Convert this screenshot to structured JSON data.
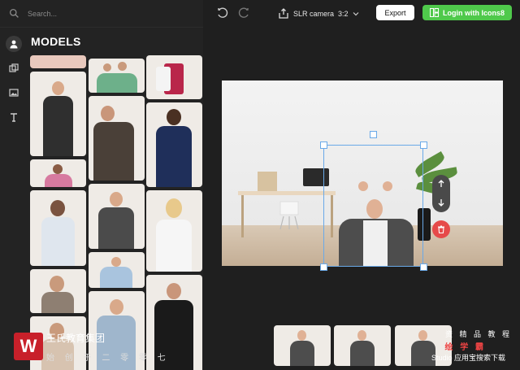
{
  "search": {
    "placeholder": "Search..."
  },
  "rail": {
    "items": [
      "models-icon",
      "layers-icon",
      "image-icon",
      "text-icon"
    ]
  },
  "panel": {
    "title": "MODELS"
  },
  "toolbar": {
    "camera_label": "SLR camera",
    "ratio_label": "3:2",
    "export_label": "Export",
    "login_label": "Login with Icons8"
  },
  "colors": {
    "accent_green": "#4fc94b",
    "selection_blue": "#6aa9e8",
    "delete_red": "#e64a4a"
  },
  "watermark": {
    "line1": "王氏教育集团",
    "line2": "始 创 于 二 零 零 七",
    "right_line1": "资 精 品 教 程",
    "right_line2": "绘 学 霸",
    "right_line3": "Studio 应用宝搜索下载"
  }
}
